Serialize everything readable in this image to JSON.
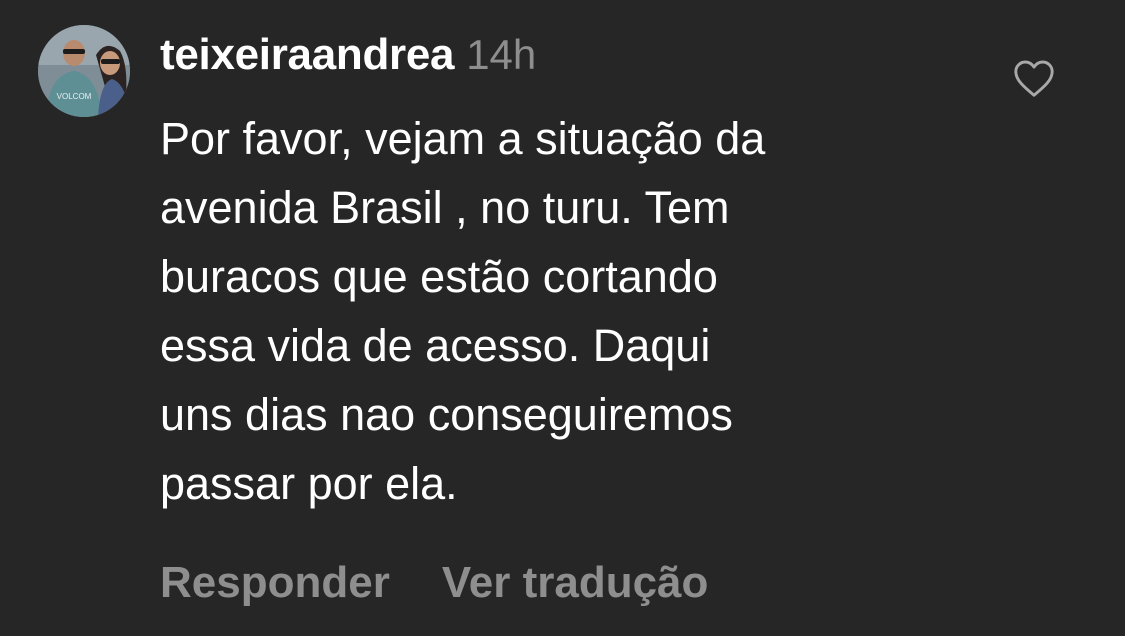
{
  "comment": {
    "avatar_icon": "profile-photo-avatar",
    "avatar_shirt_text": "VOLCOM",
    "username": "teixeiraandrea",
    "timestamp": "14h",
    "text_lines": [
      "Por favor, vejam a situação da",
      "avenida Brasil , no turu. Tem",
      "buracos que estão cortando",
      "essa vida de acesso. Daqui",
      "uns dias nao conseguiremos",
      "passar por ela."
    ],
    "like_icon": "heart-icon",
    "actions": {
      "reply_label": "Responder",
      "translate_label": "Ver tradução"
    }
  },
  "colors": {
    "background": "#262626",
    "text_primary": "#ffffff",
    "text_secondary": "#8e8e8e"
  }
}
